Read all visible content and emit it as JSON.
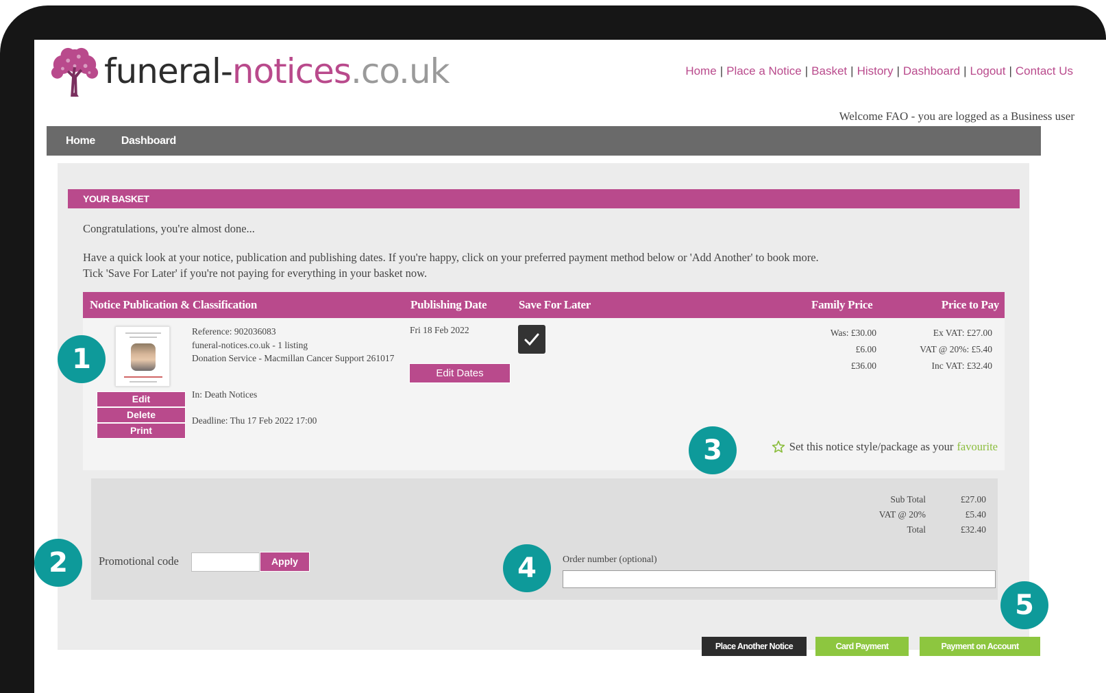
{
  "brand": {
    "part1": "funeral-",
    "part2": "notices",
    "part3": ".co.uk"
  },
  "top_nav": [
    {
      "label": "Home"
    },
    {
      "label": "Place a Notice"
    },
    {
      "label": "Basket"
    },
    {
      "label": "History"
    },
    {
      "label": "Dashboard"
    },
    {
      "label": "Logout"
    },
    {
      "label": "Contact Us"
    }
  ],
  "top_nav_separator": "|",
  "welcome": "Welcome FAO - you are logged as a Business user",
  "menu": [
    {
      "label": "Home"
    },
    {
      "label": "Dashboard"
    }
  ],
  "basket": {
    "heading": "YOUR BASKET",
    "intro1": "Congratulations, you're almost done...",
    "intro2_line1": "Have a quick look at your notice, publication and publishing dates. If you're happy, click on your preferred payment method below or 'Add Another' to book more.",
    "intro2_line2": "Tick 'Save For Later' if you're not paying for everything in your basket now."
  },
  "table_headers": {
    "notice": "Notice Publication & Classification",
    "publishing_date": "Publishing Date",
    "save_for_later": "Save For Later",
    "family_price": "Family Price",
    "price_to_pay": "Price to Pay"
  },
  "item": {
    "reference": "Reference: 902036083",
    "listing": "funeral-notices.co.uk - 1 listing",
    "donation": "Donation Service - Macmillan Cancer Support 261017",
    "in_section": "In: Death Notices",
    "deadline": "Deadline: Thu 17 Feb 2022 17:00",
    "publishing_date": "Fri 18 Feb 2022",
    "edit_dates_label": "Edit Dates",
    "save_for_later_checked": true,
    "family_price": {
      "was": "Was: £30.00",
      "vat": "£6.00",
      "total": "£36.00"
    },
    "price_to_pay": {
      "ex_vat": "Ex VAT: £27.00",
      "vat": "VAT @ 20%: £5.40",
      "inc_vat": "Inc VAT: £32.40"
    },
    "edit_label": "Edit",
    "delete_label": "Delete",
    "print_label": "Print"
  },
  "favourite": {
    "text": "Set this notice style/package as your",
    "link": "favourite"
  },
  "totals": {
    "labels": [
      "Sub Total",
      "VAT @ 20%",
      "Total"
    ],
    "values": [
      "£27.00",
      "£5.40",
      "£32.40"
    ]
  },
  "promo": {
    "label": "Promotional code",
    "value": "",
    "apply_label": "Apply"
  },
  "order": {
    "label": "Order number (optional)",
    "value": ""
  },
  "actions": {
    "place_another": "Place Another Notice",
    "card_payment": "Card Payment",
    "payment_on_account": "Payment on Account"
  },
  "callouts": [
    "1",
    "2",
    "3",
    "4",
    "5"
  ],
  "colors": {
    "brand_pink": "#b94a8c",
    "menu_grey": "#6a6a6a",
    "action_green": "#8dc63f",
    "callout_teal": "#0e9a9a"
  },
  "icons": {
    "logo": "tree-logo-icon",
    "save_for_later": "checkmark-icon",
    "favourite": "star-outline-icon"
  }
}
